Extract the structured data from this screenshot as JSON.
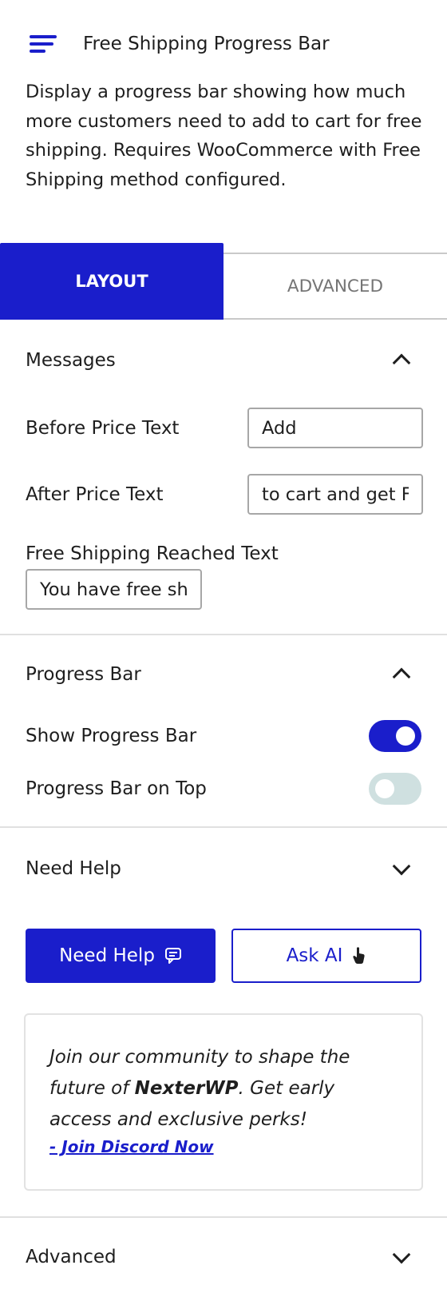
{
  "header": {
    "title": "Free Shipping Progress Bar",
    "description": "Display a progress bar showing how much more customers need to add to cart for free shipping. Requires WooCommerce with Free Shipping method configured."
  },
  "tabs": [
    {
      "label": "LAYOUT",
      "active": true
    },
    {
      "label": "ADVANCED",
      "active": false
    }
  ],
  "messages": {
    "title": "Messages",
    "before_label": "Before Price Text",
    "before_value": "Add",
    "after_label": "After Price Text",
    "after_value": "to cart and get Free Shipping",
    "reached_label": "Free Shipping Reached Text",
    "reached_value": "You have free shipping"
  },
  "progress_bar": {
    "title": "Progress Bar",
    "show_label": "Show Progress Bar",
    "show_on": true,
    "top_label": "Progress Bar on Top",
    "top_on": false
  },
  "need_help": {
    "title": "Need Help",
    "help_button": "Need Help",
    "ai_button": "Ask AI",
    "community_prefix": "Join our community to shape the future of ",
    "community_brand": "NexterWP",
    "community_suffix": ". Get early access and exclusive perks!",
    "discord_link": "- Join Discord Now"
  },
  "advanced": {
    "title": "Advanced"
  },
  "colors": {
    "accent": "#1a1ecb",
    "toggle_off": "#cfe0e0",
    "divider": "#e0e0e0"
  }
}
